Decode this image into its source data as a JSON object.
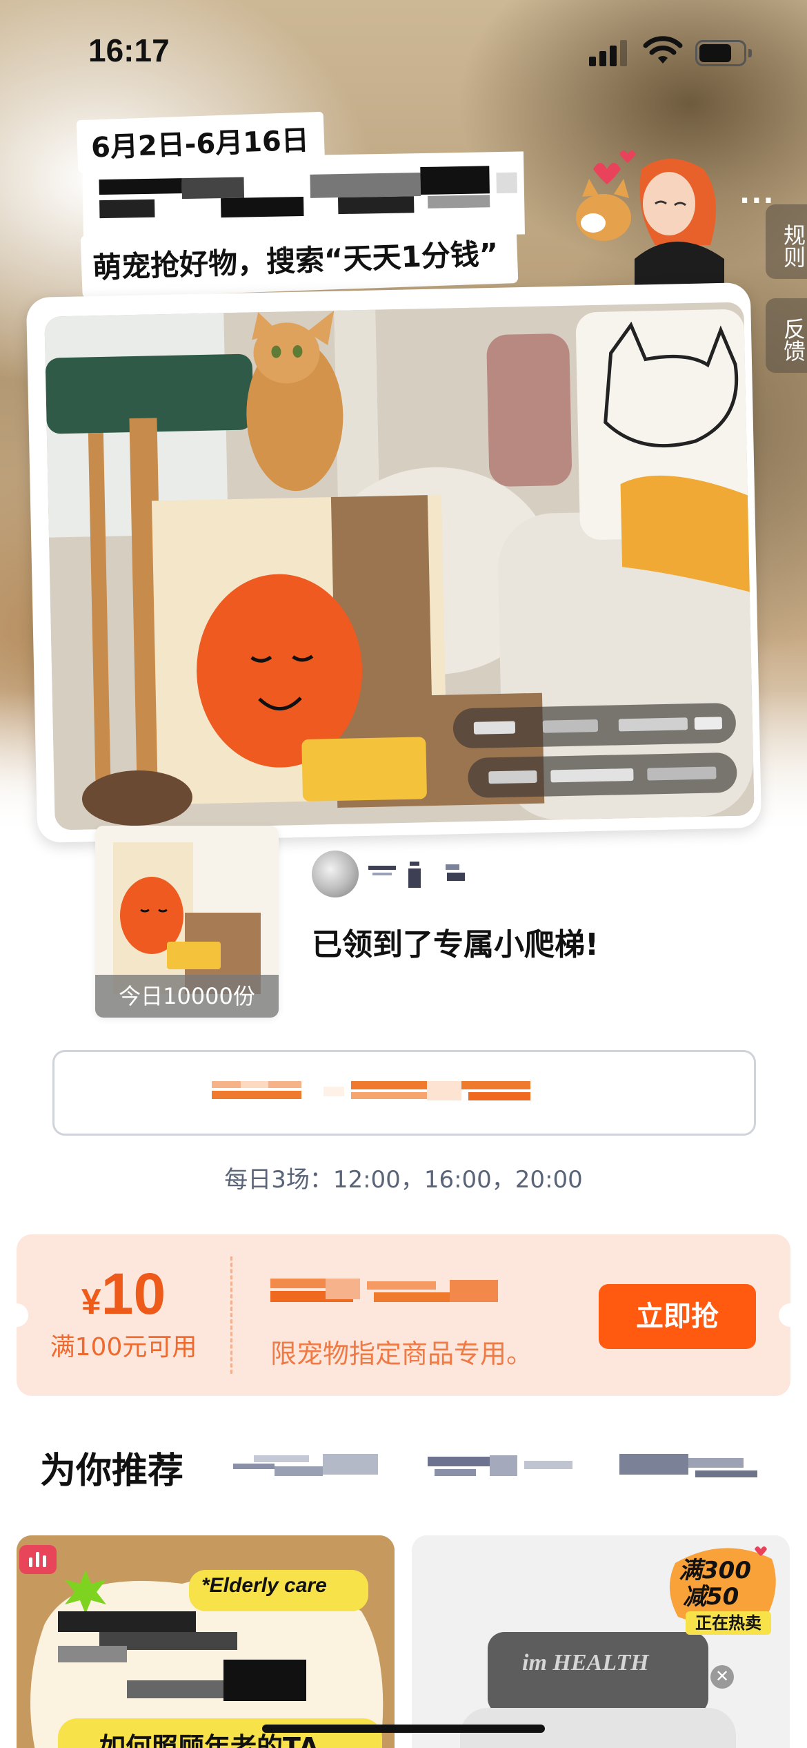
{
  "status_bar": {
    "time": "16:17"
  },
  "hero": {
    "date_range": "6月2日-6月16日",
    "slogan": "萌宠抢好物，搜索“天天1分钱”"
  },
  "side": {
    "rules_label": "规则",
    "feedback_label": "反馈",
    "more": "···"
  },
  "product": {
    "thumb_caption": "今日10000份",
    "received_text": "已领到了专属小爬梯!"
  },
  "schedule": "每日3场：12:00，16:00，20:00",
  "coupon": {
    "currency": "¥",
    "amount": "10",
    "condition": "满100元可用",
    "description": "限宠物指定商品专用。",
    "button": "立即抢"
  },
  "recommend": {
    "title": "为你推荐"
  },
  "feed": {
    "left_tag": "*Elderly care",
    "left_caption": "如何照顾年老的TA",
    "right_badge_line1": "满300",
    "right_badge_line2": "减50",
    "right_badge_line3": "正在热卖",
    "right_brand": "im HEALTH",
    "close": "✕"
  },
  "colors": {
    "accent": "#ff5a10",
    "coupon_bg": "#fde6dc",
    "coupon_text": "#ee5a1a"
  }
}
